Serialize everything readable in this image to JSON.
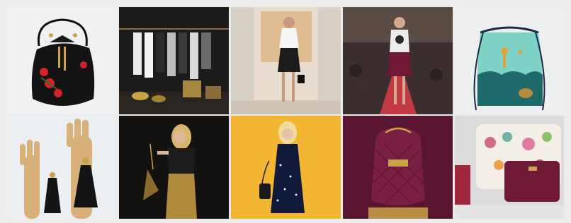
{
  "gallery": {
    "tiles": [
      {
        "subject": "black-bucket-bag-red-roses-icon",
        "bg": "#f1f1f1"
      },
      {
        "subject": "clothing-rack-boutique-icon",
        "bg": "#1d1b1a"
      },
      {
        "subject": "model-white-tee-black-skirt-icon",
        "bg": "#e7dccd"
      },
      {
        "subject": "runway-model-burgundy-skirt-icon",
        "bg": "#3a2f2e"
      },
      {
        "subject": "mint-drawstring-backpack-icon",
        "bg": "#eef0f0"
      },
      {
        "subject": "wooden-hands-tassels-icon",
        "bg": "#eceff1"
      },
      {
        "subject": "woman-gold-skirt-bag-icon",
        "bg": "#141211"
      },
      {
        "subject": "woman-sequin-dress-yellow-icon",
        "bg": "#f3b633"
      },
      {
        "subject": "quilted-burgundy-backpack-icon",
        "bg": "#5a1530"
      },
      {
        "subject": "floral-pillow-burgundy-clutch-icon",
        "bg": "#dcdcdc"
      }
    ]
  },
  "palette": {
    "gold": "#c9a24a",
    "burgundy": "#6e1a36",
    "mint": "#7fd3c6",
    "rose": "#d0242b"
  }
}
